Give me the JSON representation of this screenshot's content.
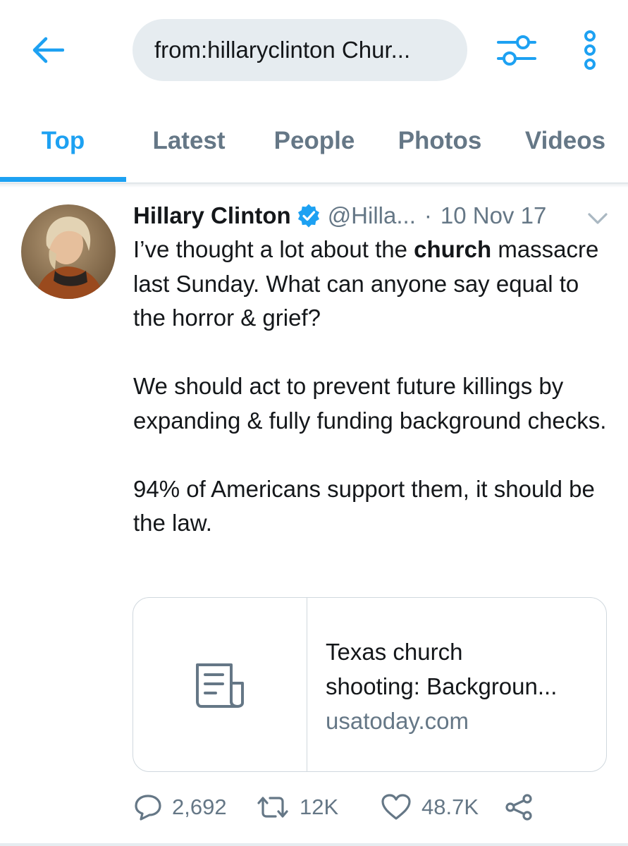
{
  "header": {
    "search_query": "from:hillaryclinton Chur..."
  },
  "tabs": [
    {
      "label": "Top"
    },
    {
      "label": "Latest"
    },
    {
      "label": "People"
    },
    {
      "label": "Photos"
    },
    {
      "label": "Videos"
    }
  ],
  "active_tab": "Top",
  "tweet": {
    "author_name": "Hillary Clinton",
    "handle": "@Hilla...",
    "separator": "·",
    "date": "10 Nov 17",
    "verified": true,
    "body": {
      "p1_before": "I’ve thought a lot about the ",
      "p1_bold": "church",
      "p1_after": " massacre last Sunday. What can anyone say equal to the horror & grief?",
      "p2": "We should act to prevent future killings by expanding & fully funding background checks.",
      "p3": "94% of Americans support them, it should be the law."
    },
    "card": {
      "title_line1": "Texas church",
      "title_line2": "shooting: Backgroun...",
      "domain": "usatoday.com"
    },
    "actions": {
      "replies": "2,692",
      "retweets": "12K",
      "likes": "48.7K"
    }
  },
  "colors": {
    "accent": "#1da1f2",
    "muted": "#657786",
    "search_bg": "#e6ecf0"
  }
}
